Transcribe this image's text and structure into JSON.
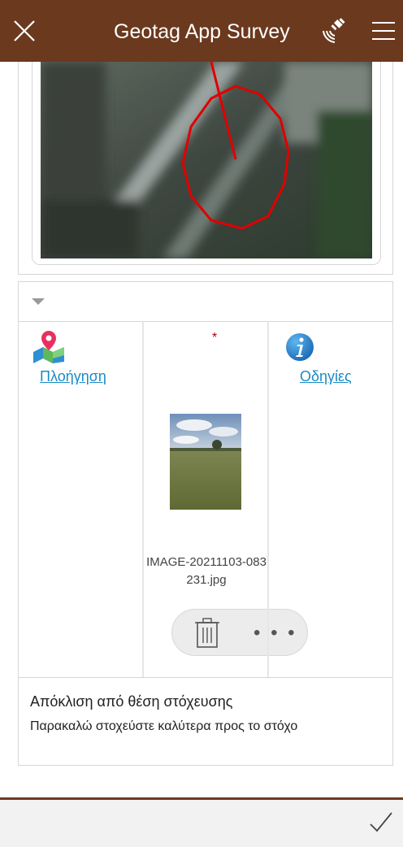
{
  "app": {
    "title": "Geotag App Survey",
    "colors": {
      "toolbar": "#6b391e",
      "link": "#1a8bc7",
      "required": "#b00000"
    }
  },
  "toolbar": {
    "close_icon": "close-icon",
    "gps_icon": "satellite-gps-icon",
    "menu_icon": "hamburger-menu-icon"
  },
  "grid": {
    "navigation_label": "Πλοήγηση",
    "required_marker": "*",
    "instructions_label": "Οδηγίες",
    "attachment": {
      "filename_line1": "IMAGE-20211103-083",
      "filename_line2": "231.jpg",
      "actions": [
        "delete",
        "more"
      ],
      "more_label": "• • •"
    }
  },
  "message": {
    "title": "Απόκλιση από θέση στόχευσης",
    "body": "Παρακαλώ στοχεύστε καλύτερα προς το στόχο"
  },
  "footer": {
    "submit_icon": "checkmark-icon"
  }
}
